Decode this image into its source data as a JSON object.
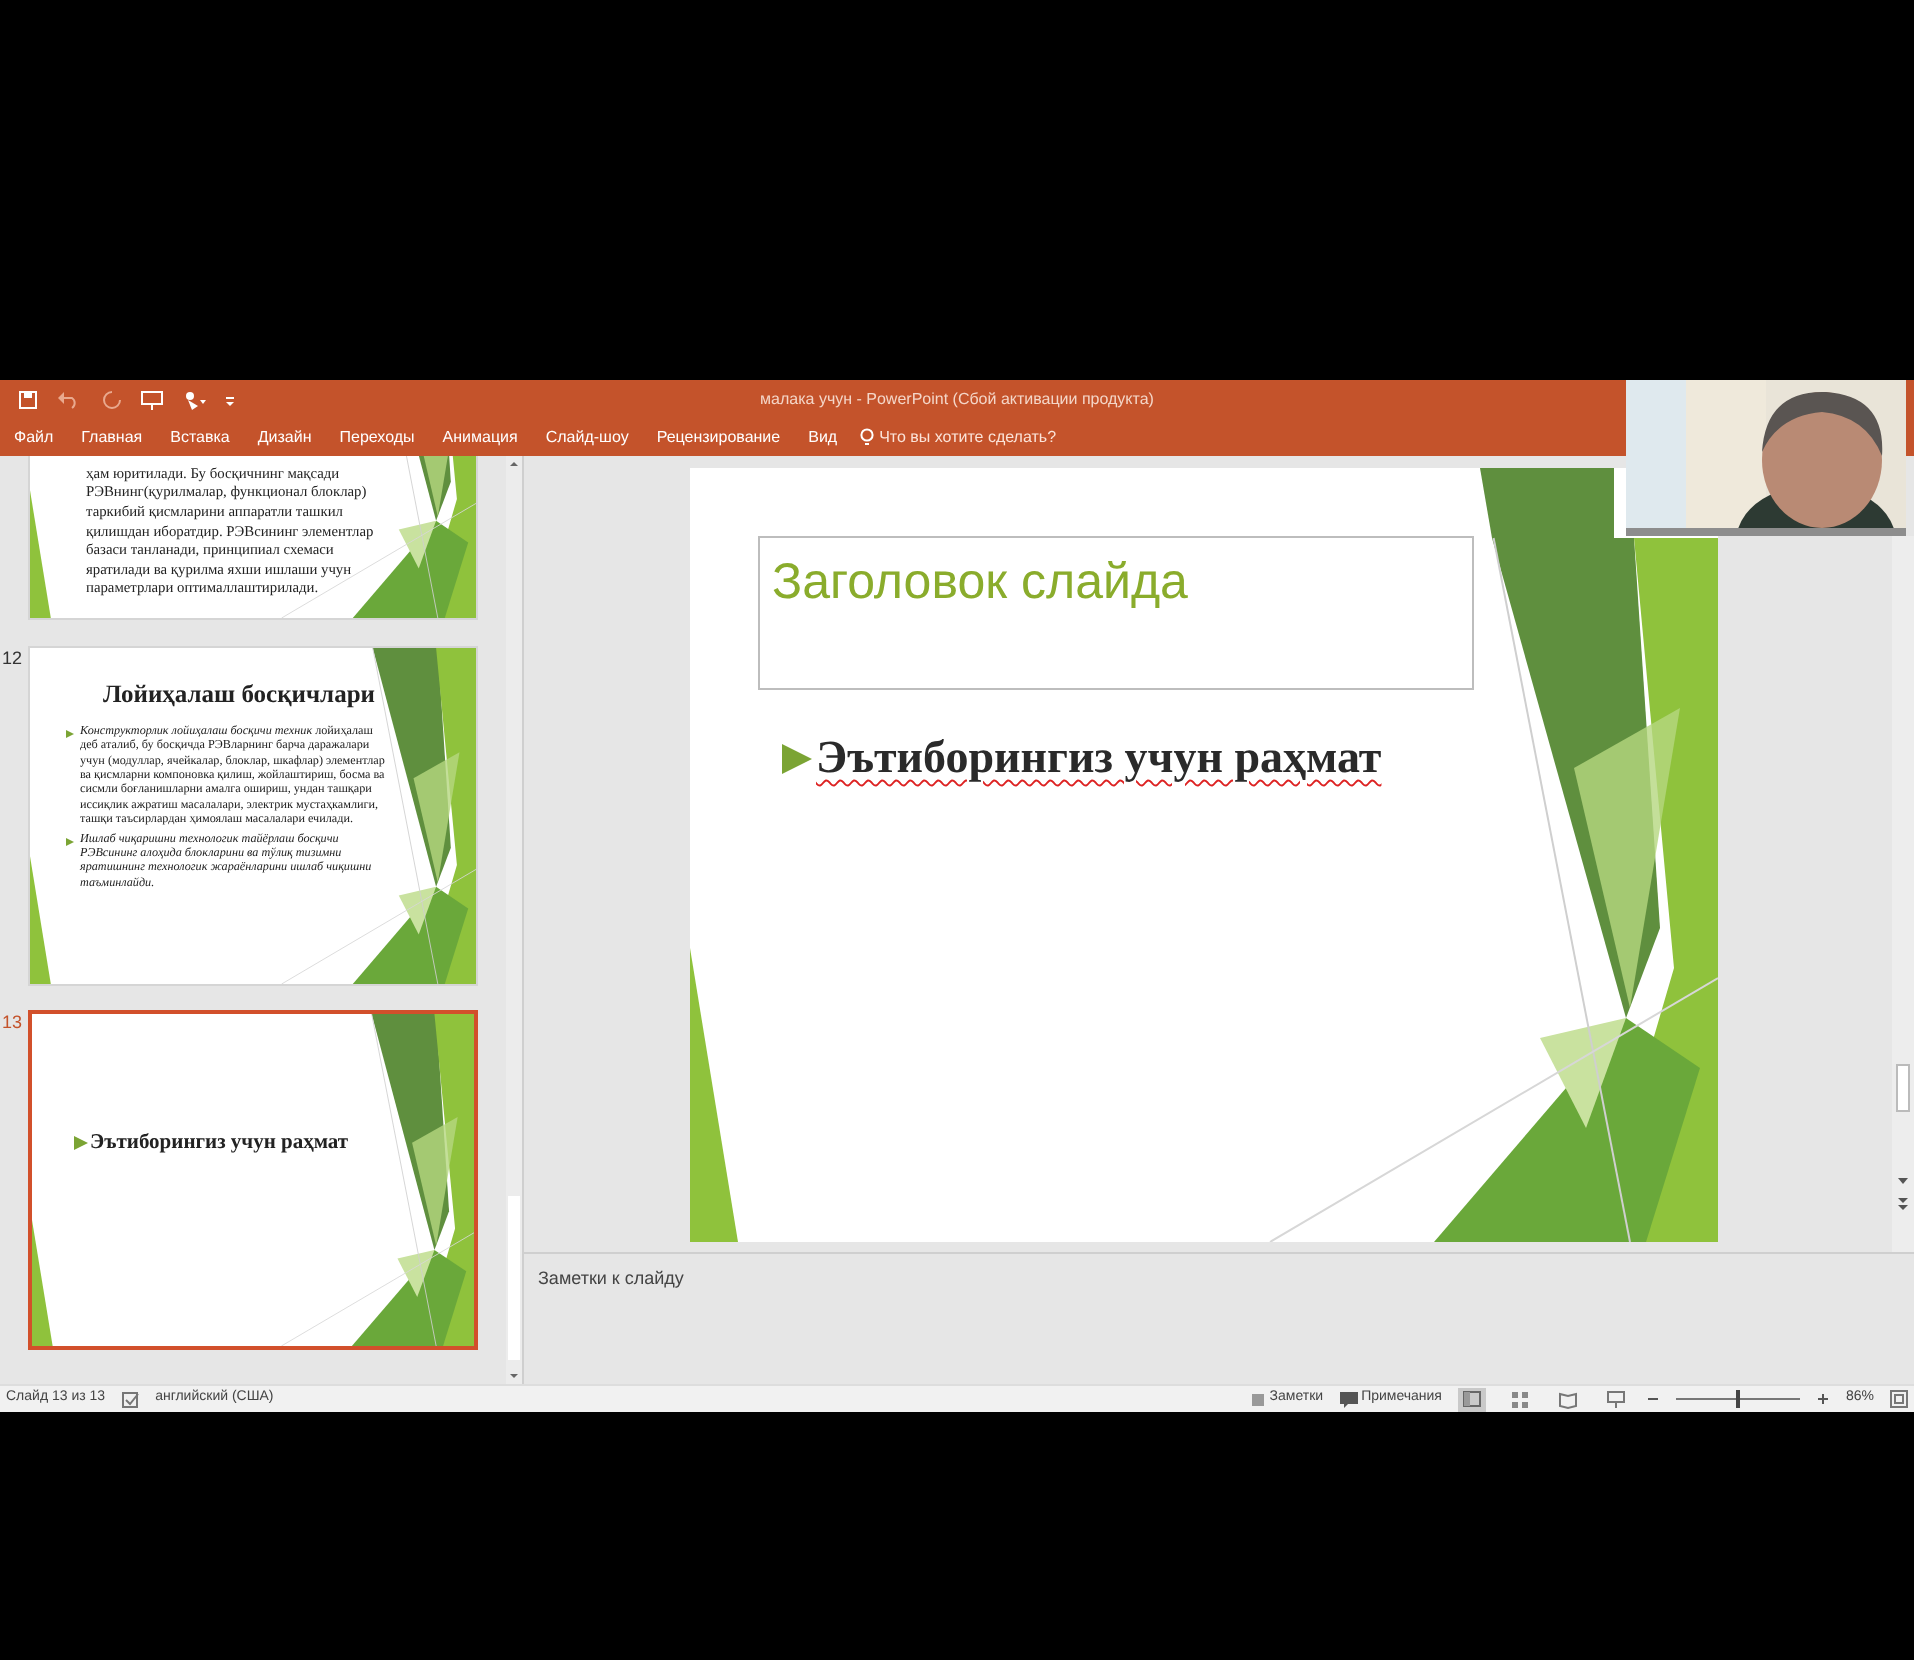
{
  "window": {
    "title": "малака учун - PowerPoint (Сбой активации продукта)"
  },
  "ribbon_tabs": [
    {
      "label": "Файл"
    },
    {
      "label": "Главная"
    },
    {
      "label": "Вставка"
    },
    {
      "label": "Дизайн"
    },
    {
      "label": "Переходы"
    },
    {
      "label": "Анимация"
    },
    {
      "label": "Слайд-шоу"
    },
    {
      "label": "Рецензирование"
    },
    {
      "label": "Вид"
    }
  ],
  "tell_me": {
    "placeholder": "Что вы хотите сделать?"
  },
  "thumbnails": [
    {
      "kind": "paragraph",
      "selected": false,
      "text": "ҳам юритилади. Бу босқичнинг мақсади РЭВнинг(қурилмалар, функционал блоклар) таркибий қисмларини аппаратли ташкил қилишдан иборатдир. РЭВсининг элементлар базаси танланади, принципиал схемаси яратилади ва қурилма яхши ишлаши учун параметрлари оптималлаштирилади."
    },
    {
      "kind": "bullets",
      "number": "12",
      "selected": false,
      "title": "Лойиҳалаш босқичлари",
      "bullets": [
        {
          "text": "*Конструкторлик лойиҳалаш босқичи техник* лойиҳалаш деб аталиб, бу босқичда РЭВларнинг барча даражалари учун (модуллар, ячейкалар, блоклар, шкафлар) элементлар ва қисмларни компоновка қилиш, жойлаштириш, босма ва сисмли боғланишларни амалга ошириш, ундан ташқари иссиқлик ажратиш масалалари, электрик мустаҳкамлиги, ташқи таъсирлардан ҳимоялаш масалалари ечилади.",
          "italic": false
        },
        {
          "text": "Ишлаб чиқаришни технологик тайёрлаш босқичи РЭВсининг алоҳида блокларини ва тўлиқ тизимни яратишнинг технологик жараёнларини ишлаб чиқишни таъминлайди.",
          "italic": true
        }
      ]
    },
    {
      "kind": "single",
      "number": "13",
      "selected": true,
      "text": "Эътиборингиз учун раҳмат"
    }
  ],
  "slide": {
    "title_placeholder": "Заголовок слайда",
    "bullet": "Эътиборингиз учун раҳмат",
    "spelling_error": true
  },
  "notes": {
    "placeholder": "Заметки к слайду"
  },
  "status_bar": {
    "slide_counter": "Слайд 13 из 13",
    "language": "английский (США)",
    "notes_button": "Заметки",
    "comments_button": "Примечания",
    "view_buttons": [
      {
        "kind": "normal",
        "selected": true
      },
      {
        "kind": "sorter",
        "selected": false
      },
      {
        "kind": "reading",
        "selected": false
      },
      {
        "kind": "slideshow",
        "selected": false
      }
    ],
    "zoom": {
      "level": 0.48,
      "reading": "86%"
    }
  }
}
